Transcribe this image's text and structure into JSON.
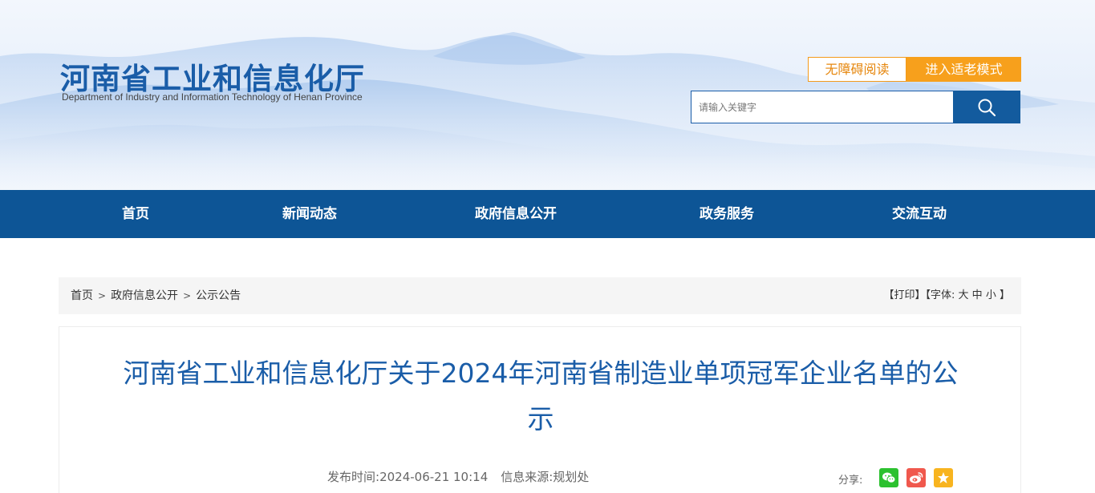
{
  "header": {
    "logo_cn": "河南省工业和信息化厅",
    "logo_en": "Department of Industry and Information Technology of Henan Province",
    "accessibility_label": "无障碍阅读",
    "elder_mode_label": "进入适老模式",
    "search_placeholder": "请输入关键字",
    "icons": [
      "search-icon"
    ]
  },
  "nav": {
    "items": [
      {
        "label": "首页"
      },
      {
        "label": "新闻动态"
      },
      {
        "label": "政府信息公开"
      },
      {
        "label": "政务服务"
      },
      {
        "label": "交流互动"
      }
    ]
  },
  "breadcrumb": {
    "items": [
      "首页",
      "政府信息公开",
      "公示公告"
    ],
    "separator": ">"
  },
  "tools": {
    "print_label": "【打印】",
    "font_prefix": "【字体:",
    "font_large": "大",
    "font_medium": "中",
    "font_small": "小",
    "font_suffix": "】"
  },
  "article": {
    "title": "河南省工业和信息化厅关于2024年河南省制造业单项冠军企业名单的公示",
    "publish_label": "发布时间:",
    "publish_time": "2024-06-21 10:14",
    "source_label": "信息来源:",
    "source": "规划处",
    "share_label": "分享:",
    "share_icons": [
      "wechat-icon",
      "weibo-icon",
      "favorite-icon"
    ]
  },
  "colors": {
    "brand_blue": "#1a5da8",
    "nav_blue": "#0d5596",
    "accent_orange": "#f7a01c",
    "wechat_green": "#2cc12f",
    "weibo_red": "#f0584d",
    "favorite_yellow": "#f8b41f"
  }
}
